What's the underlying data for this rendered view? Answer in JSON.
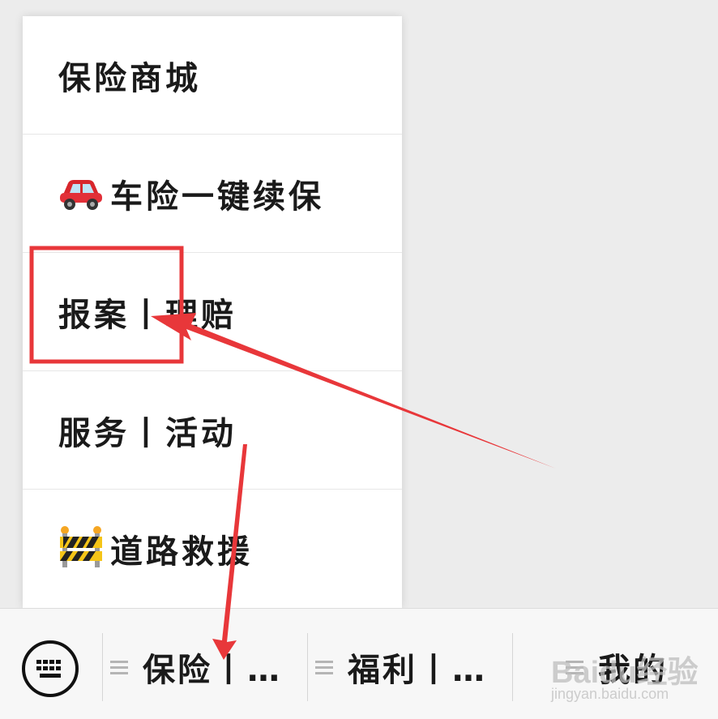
{
  "menu": {
    "items": [
      {
        "emoji": "",
        "label": "保险商城"
      },
      {
        "emoji": "🚗",
        "label": "车险一键续保"
      },
      {
        "emoji": "",
        "label": "报案丨理赔"
      },
      {
        "emoji": "",
        "label": "服务丨活动"
      },
      {
        "emoji": "🚧",
        "label": "道路救援"
      }
    ]
  },
  "bottom_bar": {
    "keyboard_icon": "keyboard-icon",
    "tabs": [
      {
        "label": "保险丨…",
        "icon": "menu-lines-icon"
      },
      {
        "label": "福利丨…",
        "icon": "menu-lines-icon"
      },
      {
        "label": "我的",
        "icon": "menu-lines-icon"
      }
    ]
  },
  "annotation": {
    "color": "#e8373a"
  },
  "watermark": {
    "main": "Baidu经验",
    "sub": "jingyan.baidu.com"
  }
}
